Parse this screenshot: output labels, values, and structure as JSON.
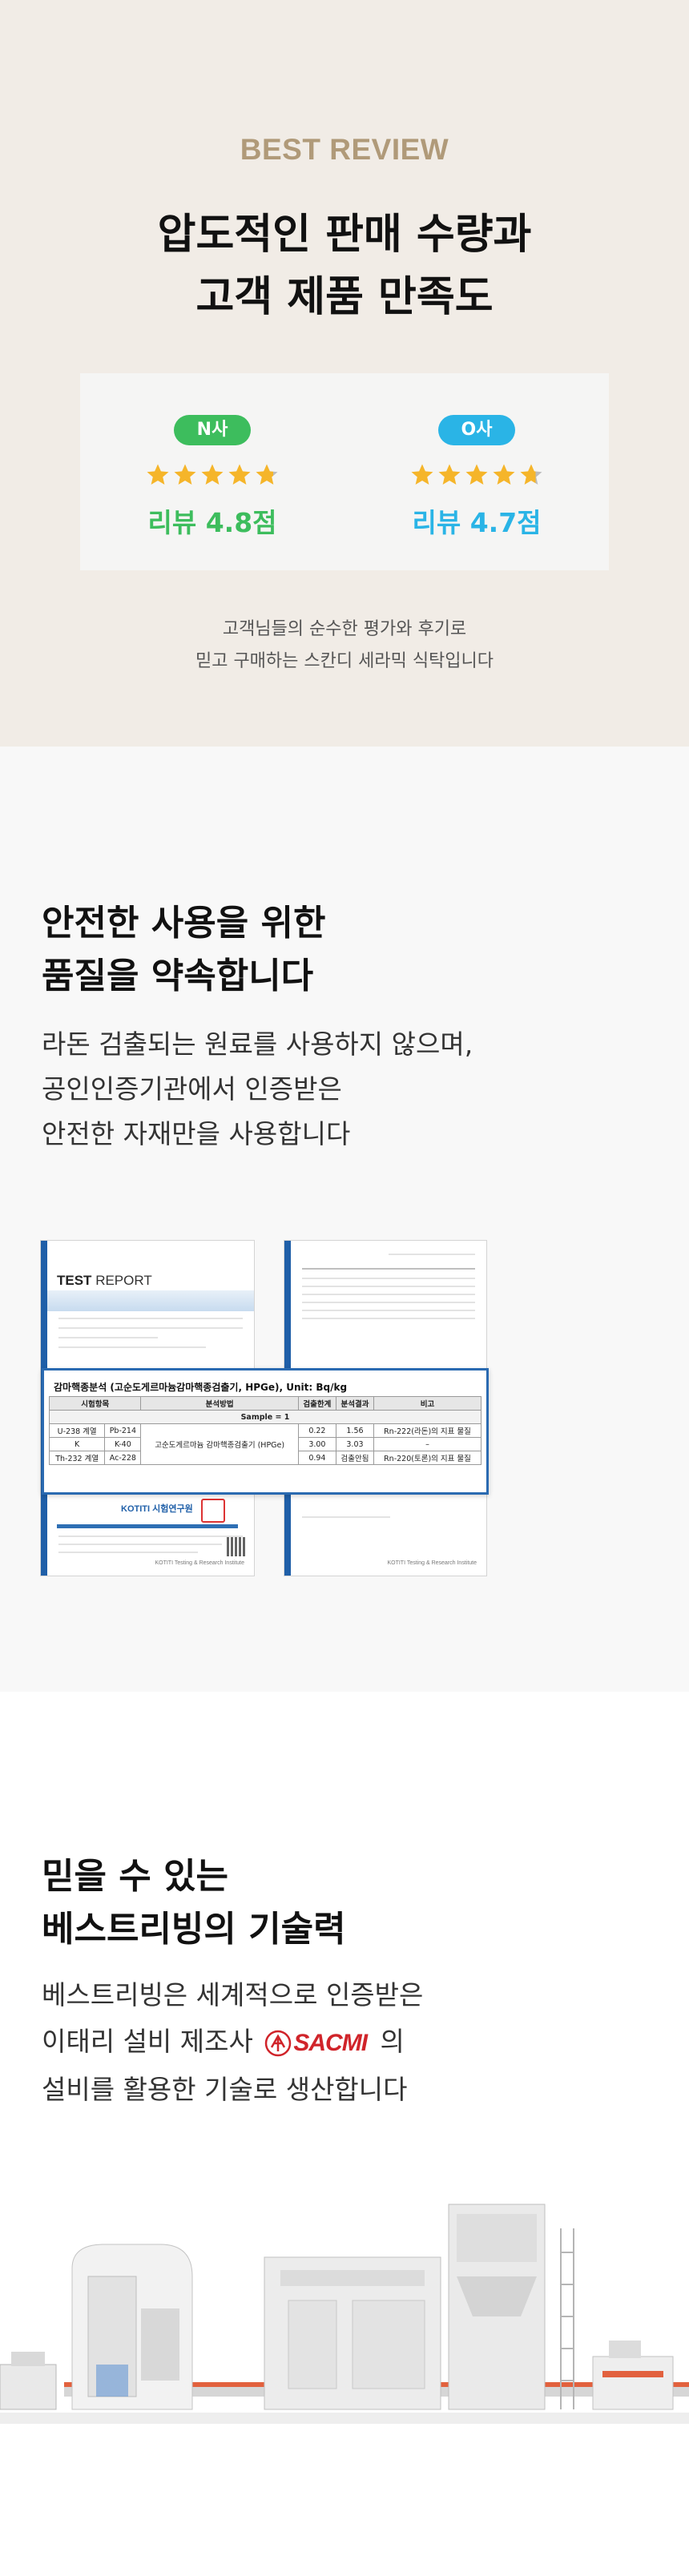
{
  "review": {
    "eyebrow": "BEST REVIEW",
    "headline": [
      "압도적인 판매 수량과",
      "고객 제품 만족도"
    ],
    "platforms": [
      {
        "name": "N사",
        "stars": 4.8,
        "score_text": "리뷰 4.8점",
        "color": "#3dbd5d"
      },
      {
        "name": "O사",
        "stars": 4.7,
        "score_text": "리뷰 4.7점",
        "color": "#2ab4e6"
      }
    ],
    "star_color": "#f5b52a",
    "star_empty_color": "#bcbcbc",
    "description": [
      "고객님들의 순수한 평가와 후기로",
      "믿고 구매하는 스칸디 세라믹 식탁입니다"
    ]
  },
  "quality": {
    "heading": [
      "안전한 사용을 위한",
      "품질을 약속합니다"
    ],
    "body": [
      "라돈 검출되는 원료를 사용하지 않으며,",
      "공인인증기관에서 인증받은",
      "안전한 자재만을 사용합니다"
    ],
    "report": {
      "title_test": "TEST",
      "title_report": "REPORT",
      "lab_logo": "KOTITI 시험연구원",
      "footer": "KOTITI Testing & Research Institute",
      "table_title": "감마핵종분석 (고순도게르마늄감마핵종검출기, HPGe), Unit: Bq/kg",
      "columns": [
        "시험항목",
        "",
        "분석방법",
        "검출한계",
        "분석결과",
        "비고"
      ],
      "sample_label": "Sample = 1",
      "rows": [
        [
          "U-238 계열",
          "Pb-214",
          "고순도게르마늄 감마핵종검출기 (HPGe)",
          "0.22",
          "1.56",
          "Rn-222(라돈)의 지표 물질"
        ],
        [
          "K",
          "K-40",
          "",
          "3.00",
          "3.03",
          "–"
        ],
        [
          "Th-232 계열",
          "Ac-228",
          "",
          "0.94",
          "검출안됨",
          "Rn-220(토론)의 지표 물질"
        ]
      ]
    }
  },
  "tech": {
    "heading": [
      "믿을 수 있는",
      "베스트리빙의 기술력"
    ],
    "body_line1": "베스트리빙은 세계적으로 인증받은",
    "body_line2_pre": "이태리 설비 제조사",
    "sacmi_logo_text": "SACMI",
    "body_line2_post": "의",
    "body_line3": "설비를 활용한 기술로 생산합니다"
  }
}
